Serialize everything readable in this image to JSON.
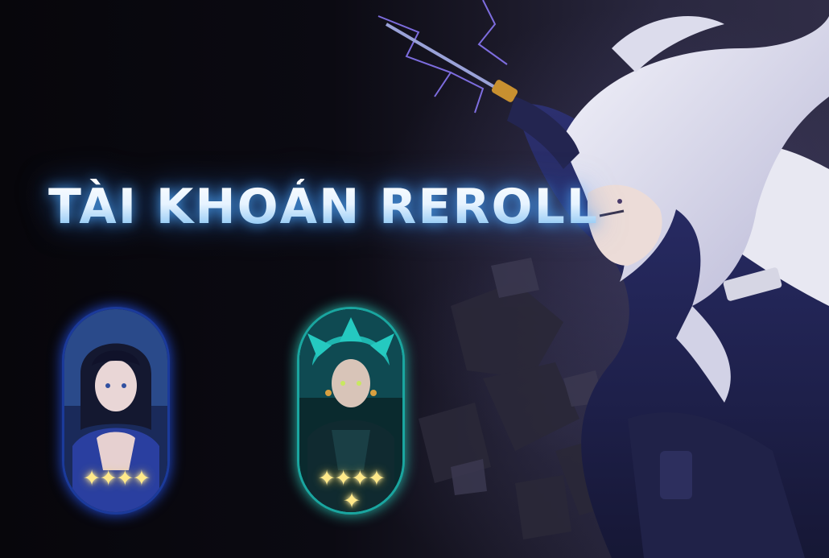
{
  "banner": {
    "title": "TÀI KHOẢN REROLL"
  },
  "characters": [
    {
      "name": "",
      "rarity": 4,
      "stars_top": "✦✦✦✦",
      "stars_bottom": "",
      "glow_color": "#2a5cff"
    },
    {
      "name": "",
      "rarity": 5,
      "stars_top": "✦✦✦✦",
      "stars_bottom": "✦",
      "glow_color": "#34e0d0"
    }
  ],
  "colors": {
    "background": "#08070c",
    "title_glow": "#5ab0ff",
    "star": "#ffe98a"
  }
}
